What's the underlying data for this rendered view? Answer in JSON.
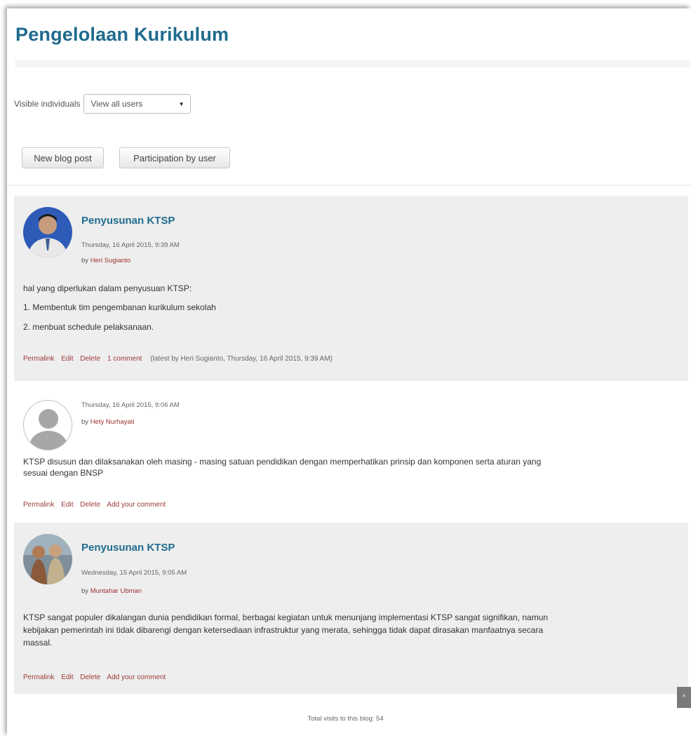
{
  "page": {
    "title": "Pengelolaan Kurikulum"
  },
  "filter": {
    "label": "Visible individuals",
    "selected": "View all users"
  },
  "buttons": {
    "new_post": "New blog post",
    "participation": "Participation by user"
  },
  "posts": [
    {
      "title": "Penyusunan KTSP",
      "date": "Thursday, 16 April 2015, 9:39 AM",
      "by_label": "by",
      "author": "Heri Sugianto",
      "body": [
        "hal yang diperlukan dalam penyusuan KTSP:",
        "1. Membentuk tim pengembanan kurikulum sekolah",
        "2. menbuat schedule pelaksanaan."
      ],
      "actions": {
        "permalink": "Permalink",
        "edit": "Edit",
        "delete": "Delete",
        "comment": "1 comment"
      },
      "comment_meta": "(latest by Heri Sugianto, Thursday, 16 April 2015, 9:39 AM)"
    },
    {
      "date": "Thursday, 16 April 2015, 9:06 AM",
      "by_label": "by",
      "author": "Hety Nurhayati",
      "body": [
        "KTSP disusun dan dilaksanakan oleh masing - masing satuan pendidikan dengan memperhatikan prinsip dan komponen serta aturan yang",
        "sesuai dengan BNSP"
      ],
      "actions": {
        "permalink": "Permalink",
        "edit": "Edit",
        "delete": "Delete",
        "comment": "Add your comment"
      }
    },
    {
      "title": "Penyusunan KTSP",
      "date": "Wednesday, 15 April 2015, 9:05 AM",
      "by_label": "by",
      "author": "Muntahar Ubman",
      "body": [
        "KTSP sangat populer dikalangan dunia pendidikan formal, berbagai kegiatan untuk menunjang implementasi KTSP sangat signifikan, namun",
        "kebijakan pemerintah ini tidak dibarengi dengan ketersediaan infrastruktur yang merata, sehingga tidak dapat dirasakan manfaatnya secara",
        "massal."
      ],
      "actions": {
        "permalink": "Permalink",
        "edit": "Edit",
        "delete": "Delete",
        "comment": "Add your comment"
      }
    }
  ],
  "footer": {
    "visits": "Total visits to this blog: 54"
  },
  "icons": {
    "scroll_top": "chevron-up-icon",
    "select_caret": "dropdown-caret-icon"
  }
}
